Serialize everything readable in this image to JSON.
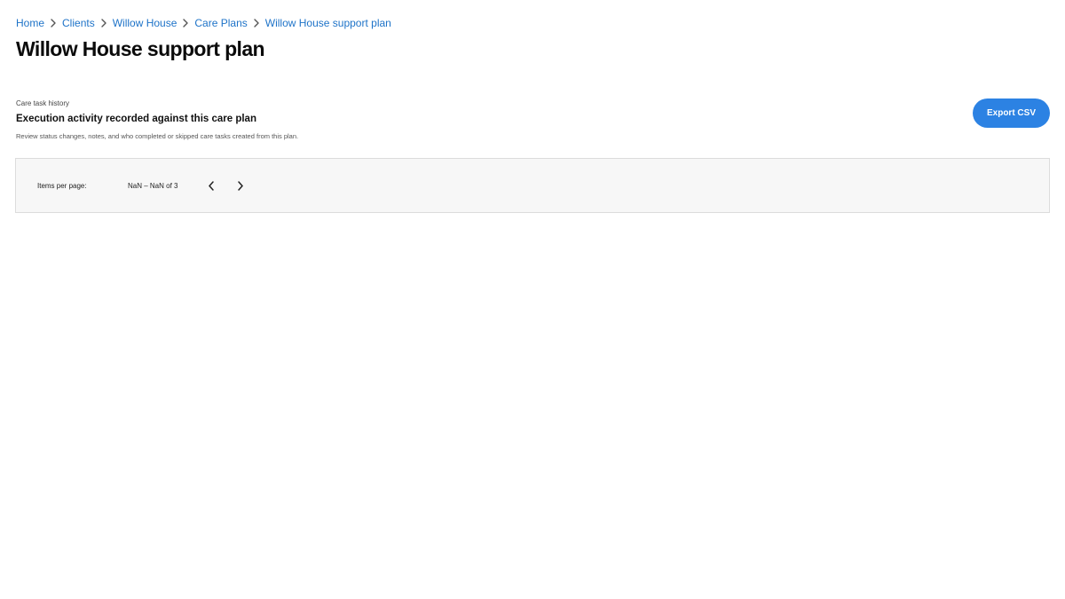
{
  "breadcrumb": {
    "items": [
      "Home",
      "Clients",
      "Willow House",
      "Care Plans",
      "Willow House support plan"
    ]
  },
  "page": {
    "title": "Willow House support plan"
  },
  "section": {
    "eyebrow": "Care task history",
    "heading": "Execution activity recorded against this care plan",
    "description": "Review status changes, notes, and who completed or skipped care tasks created from this plan."
  },
  "actions": {
    "export_label": "Export CSV"
  },
  "pager": {
    "items_per_page_label": "Items per page:",
    "range_text": "NaN – NaN of 3",
    "prev_icon": "chevron-left-icon",
    "next_icon": "chevron-right-icon"
  },
  "colors": {
    "link": "#1e73c8",
    "accent": "#2c82e3",
    "panel_bg": "#f7f7f7",
    "panel_border": "#dcdcdc"
  }
}
